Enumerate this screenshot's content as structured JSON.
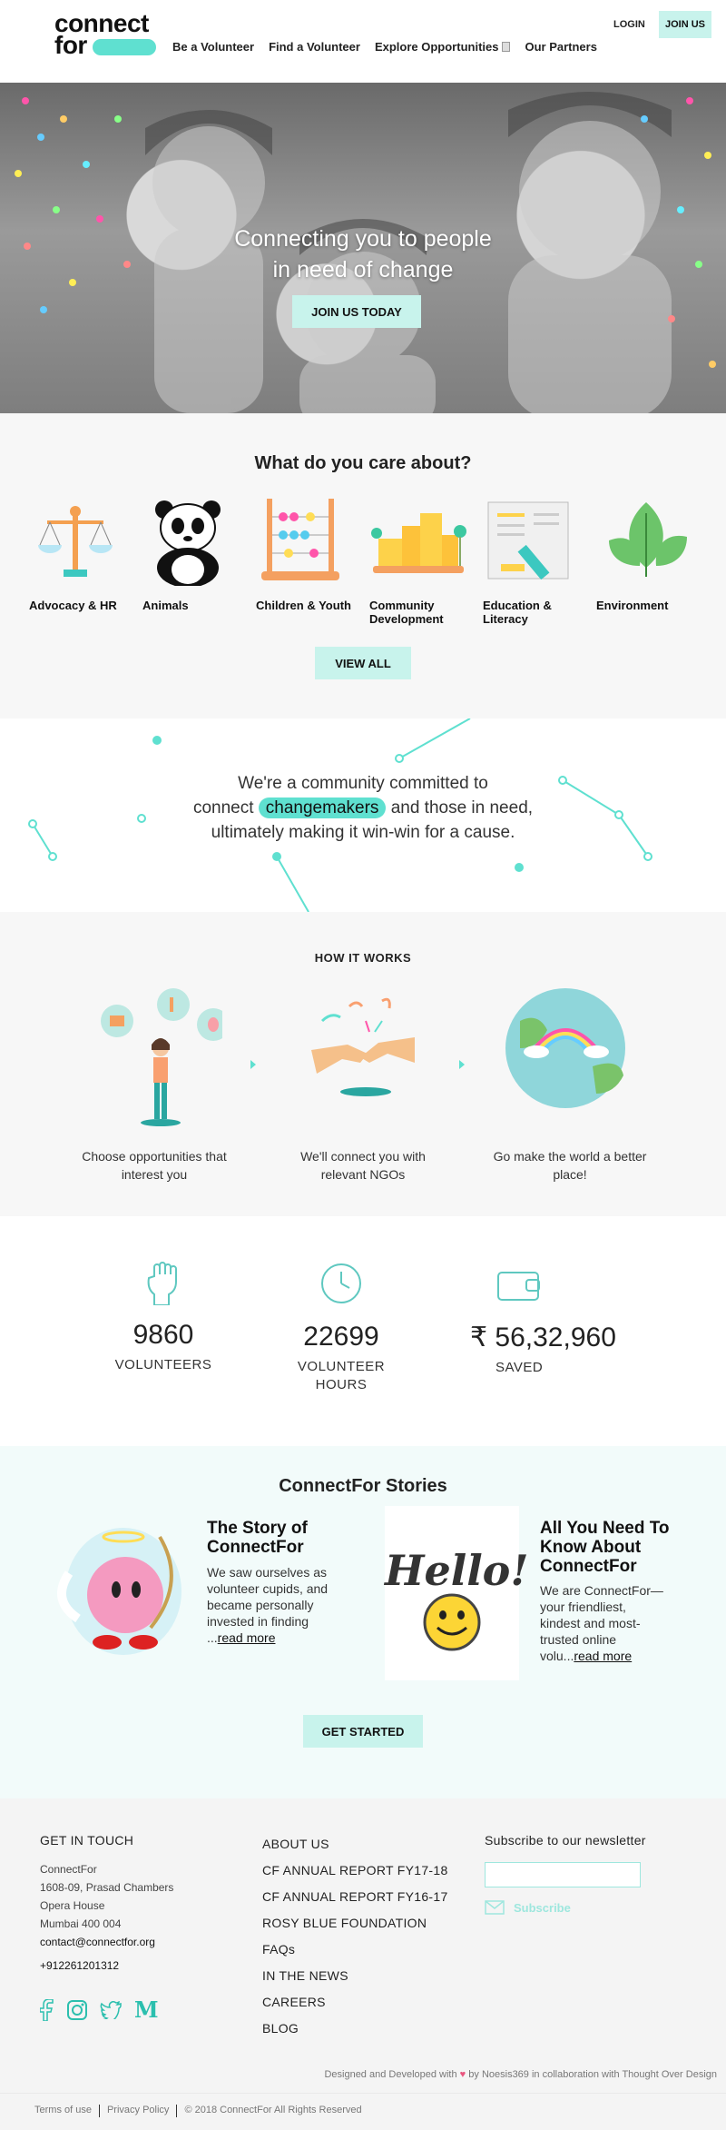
{
  "header": {
    "logo_line1": "connect",
    "logo_line2": "for",
    "nav": [
      "Be a Volunteer",
      "Find a Volunteer",
      "Explore Opportunities",
      "Our Partners"
    ],
    "login": "LOGIN",
    "join": "JOIN US"
  },
  "hero": {
    "title_line1": "Connecting you to people",
    "title_line2": "in need of change",
    "button": "JOIN US TODAY"
  },
  "causes": {
    "title": "What do you care about?",
    "items": [
      {
        "label": "Advocacy & HR",
        "icon": "scales-icon"
      },
      {
        "label": "Animals",
        "icon": "panda-icon"
      },
      {
        "label": "Children & Youth",
        "icon": "abacus-icon"
      },
      {
        "label": "Community Development",
        "icon": "buildings-icon"
      },
      {
        "label": "Education & Literacy",
        "icon": "book-icon"
      },
      {
        "label": "Environment",
        "icon": "leaves-icon"
      }
    ],
    "view_all": "VIEW ALL"
  },
  "community": {
    "line1": "We're a community committed to",
    "line2_pre": "connect",
    "highlight": "changemakers",
    "line2_post": "and those in need,",
    "line3": "ultimately making it win-win for a cause."
  },
  "how": {
    "title": "HOW IT WORKS",
    "steps": [
      {
        "text": "Choose opportunities that interest you"
      },
      {
        "text": "We'll connect you with relevant NGOs"
      },
      {
        "text": "Go make the world a better place!"
      }
    ]
  },
  "stats": [
    {
      "value": "9860",
      "label": "VOLUNTEERS",
      "icon": "fist-icon"
    },
    {
      "value": "22699",
      "label": "VOLUNTEER HOURS",
      "icon": "clock-icon"
    },
    {
      "value": "₹ 56,32,960",
      "label": "SAVED",
      "icon": "wallet-icon"
    }
  ],
  "stories": {
    "title": "ConnectFor Stories",
    "items": [
      {
        "title": "The Story of ConnectFor",
        "body": "We saw ourselves as volunteer cupids, and became personally invested in finding ...",
        "link": "read more"
      },
      {
        "title": "All You Need To Know About ConnectFor",
        "body": "We are ConnectFor— your friendliest, kindest and most-trusted online volu...",
        "link": "read more"
      }
    ],
    "hello_text": "Hello!",
    "button": "GET STARTED"
  },
  "footer": {
    "touch_title": "GET IN TOUCH",
    "address": [
      "ConnectFor",
      "1608-09, Prasad Chambers",
      "Opera House",
      "Mumbai 400 004"
    ],
    "email": "contact@connectfor.org",
    "phone": "+912261201312",
    "links": [
      "ABOUT US",
      "CF ANNUAL REPORT FY17-18",
      "CF ANNUAL REPORT FY16-17",
      "ROSY BLUE FOUNDATION",
      "FAQs",
      "IN THE NEWS",
      "CAREERS",
      "BLOG"
    ],
    "newsletter_title": "Subscribe to our newsletter",
    "subscribe": "Subscribe",
    "credit_pre": "Designed and Developed with",
    "credit_post": "by Noesis369 in collaboration with Thought Over Design",
    "medium": "M"
  },
  "bottom": {
    "terms": "Terms of use",
    "privacy": "Privacy Policy",
    "copyright": "© 2018 ConnectFor All Rights Reserved"
  },
  "colors": {
    "accent": "#5fe0d0",
    "soft": "#c8f3ec"
  }
}
